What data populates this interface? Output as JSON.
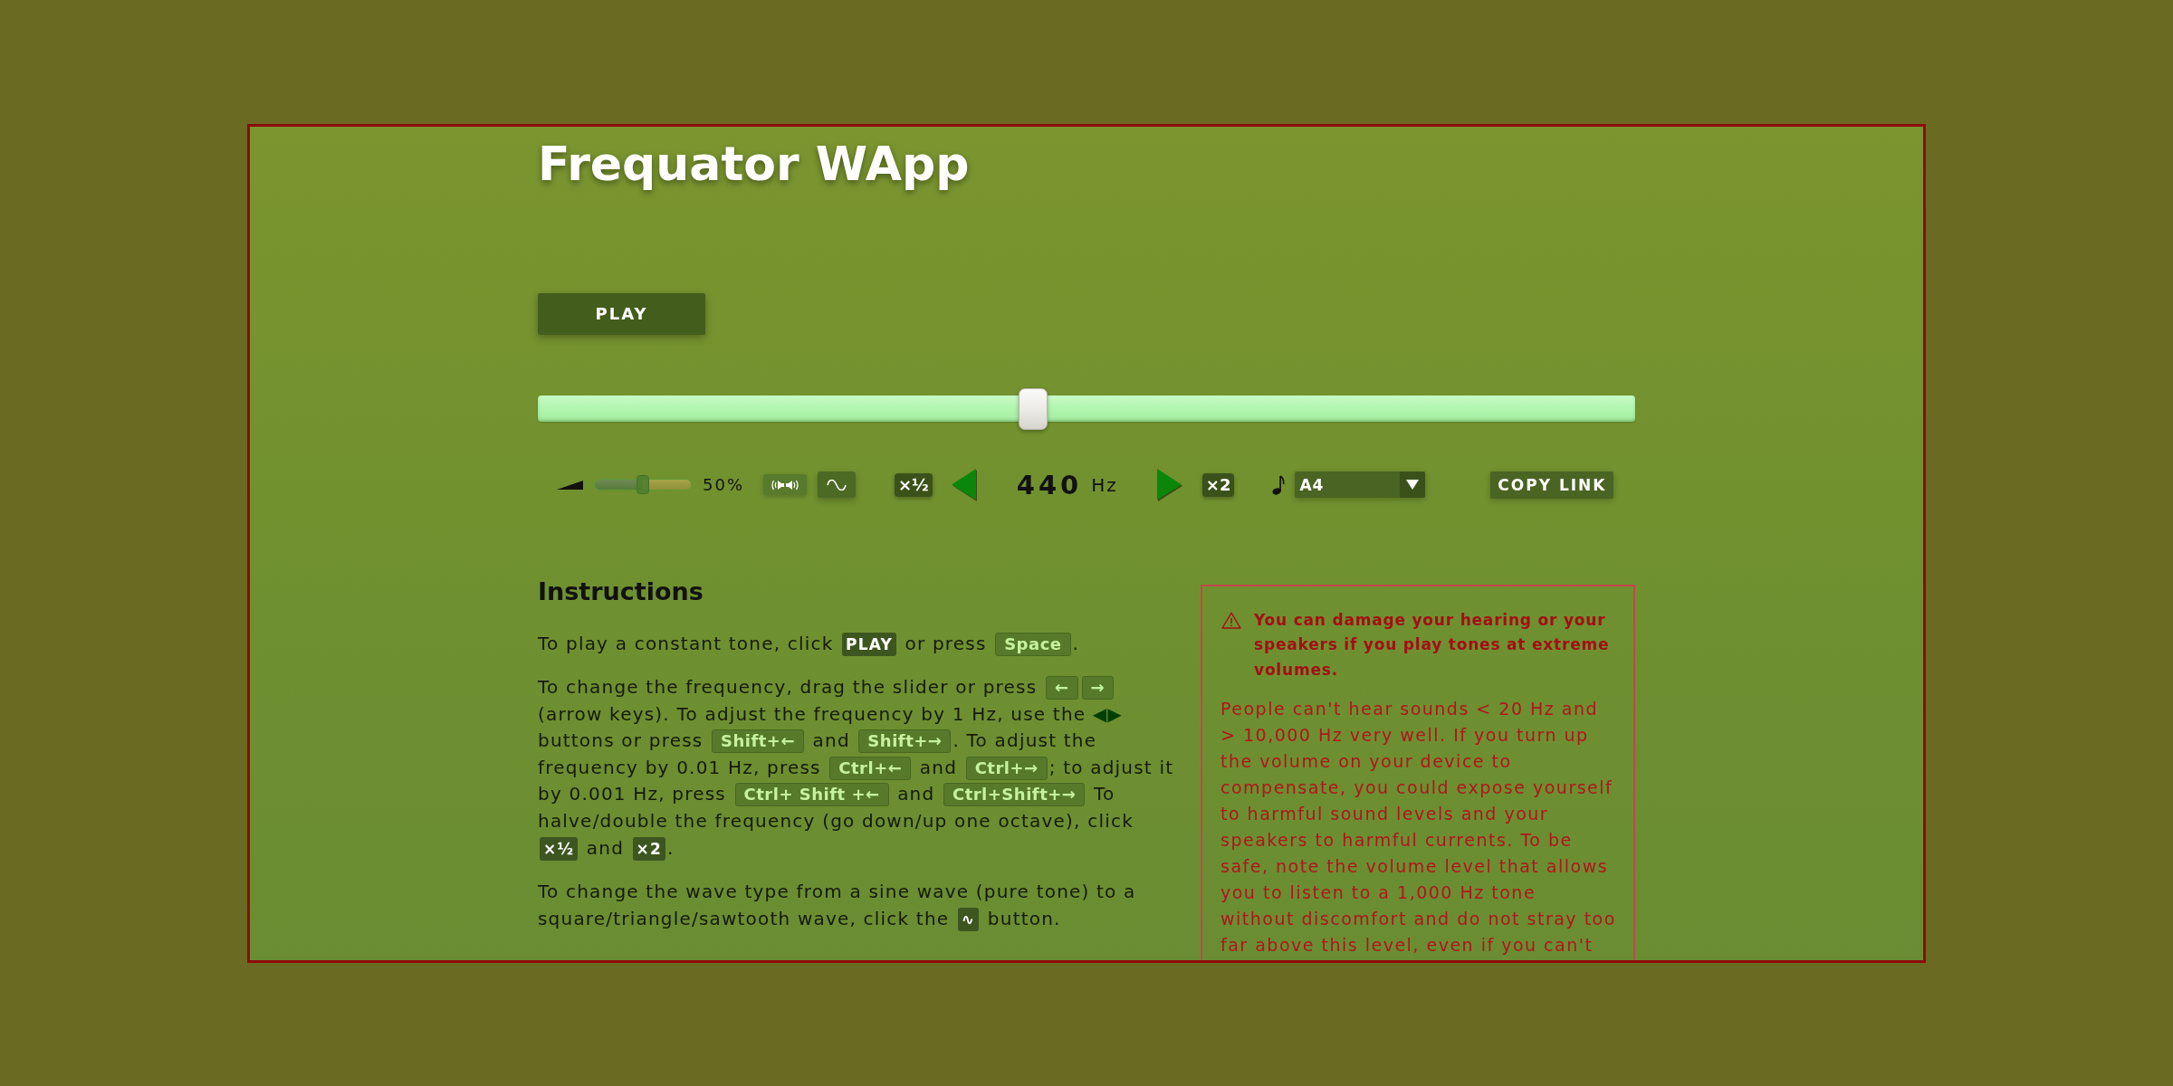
{
  "title": "Frequator WApp",
  "play_button": {
    "label": "PLAY"
  },
  "frequency_slider": {
    "level": 0.45
  },
  "controls": {
    "volume": {
      "level": 0.5,
      "reading": "50%"
    },
    "halve_button": {
      "label": "×½"
    },
    "frequency": {
      "value": "440",
      "unit": "Hz"
    },
    "double_button": {
      "label": "×2"
    },
    "note_select": {
      "value": "A4"
    },
    "copy_link_button": {
      "label": "COPY LINK"
    }
  },
  "instructions": {
    "heading": "Instructions",
    "paragraphs": [
      [
        {
          "kind": "text",
          "text": "To play a constant tone, click "
        },
        {
          "kind": "button",
          "text": "PLAY"
        },
        {
          "kind": "text",
          "text": " or press "
        },
        {
          "kind": "key",
          "text": "Space"
        },
        {
          "kind": "text",
          "text": "."
        }
      ],
      [
        {
          "kind": "text",
          "text": "To change the frequency, drag the slider or press "
        },
        {
          "kind": "key",
          "text": "←"
        },
        {
          "kind": "key",
          "text": "→"
        },
        {
          "kind": "text",
          "text": " (arrow keys). To adjust the frequency by 1 Hz, use the "
        },
        {
          "kind": "glyph",
          "text": "◀▶"
        },
        {
          "kind": "text",
          "text": " buttons or press "
        },
        {
          "kind": "key",
          "text": "Shift+←"
        },
        {
          "kind": "text",
          "text": " and "
        },
        {
          "kind": "key",
          "text": "Shift+→"
        },
        {
          "kind": "text",
          "text": ". To adjust the frequency by 0.01 Hz, press "
        },
        {
          "kind": "key",
          "text": "Ctrl+←"
        },
        {
          "kind": "text",
          "text": " and "
        },
        {
          "kind": "key",
          "text": "Ctrl+→"
        },
        {
          "kind": "text",
          "text": "; to adjust it by 0.001 Hz, press "
        },
        {
          "kind": "key",
          "text": "Ctrl+ Shift +←"
        },
        {
          "kind": "text",
          "text": " and "
        },
        {
          "kind": "key",
          "text": "Ctrl+Shift+→"
        },
        {
          "kind": "text",
          "text": " To halve/double the frequency (go down/up one octave), click "
        },
        {
          "kind": "button",
          "text": "×½"
        },
        {
          "kind": "text",
          "text": " and "
        },
        {
          "kind": "button",
          "text": "×2"
        },
        {
          "kind": "text",
          "text": "."
        }
      ],
      [
        {
          "kind": "text",
          "text": "To change the wave type from a sine wave (pure tone) to a square/triangle/sawtooth wave, click the "
        },
        {
          "kind": "button",
          "text": "∿"
        },
        {
          "kind": "text",
          "text": " button."
        }
      ]
    ]
  },
  "warning": {
    "heading": "You can damage your hearing or your speakers if you play tones at extreme volumes.",
    "text": "People can't hear sounds < 20 Hz and > 10,000 Hz very well. If you turn up the volume on your device to compensate, you could expose yourself to harmful sound levels and your speakers to harmful currents. To be safe, note the volume level that allows you to listen to a 1,000 Hz tone without discomfort and do not stray too far above this level, even if you can't"
  }
}
